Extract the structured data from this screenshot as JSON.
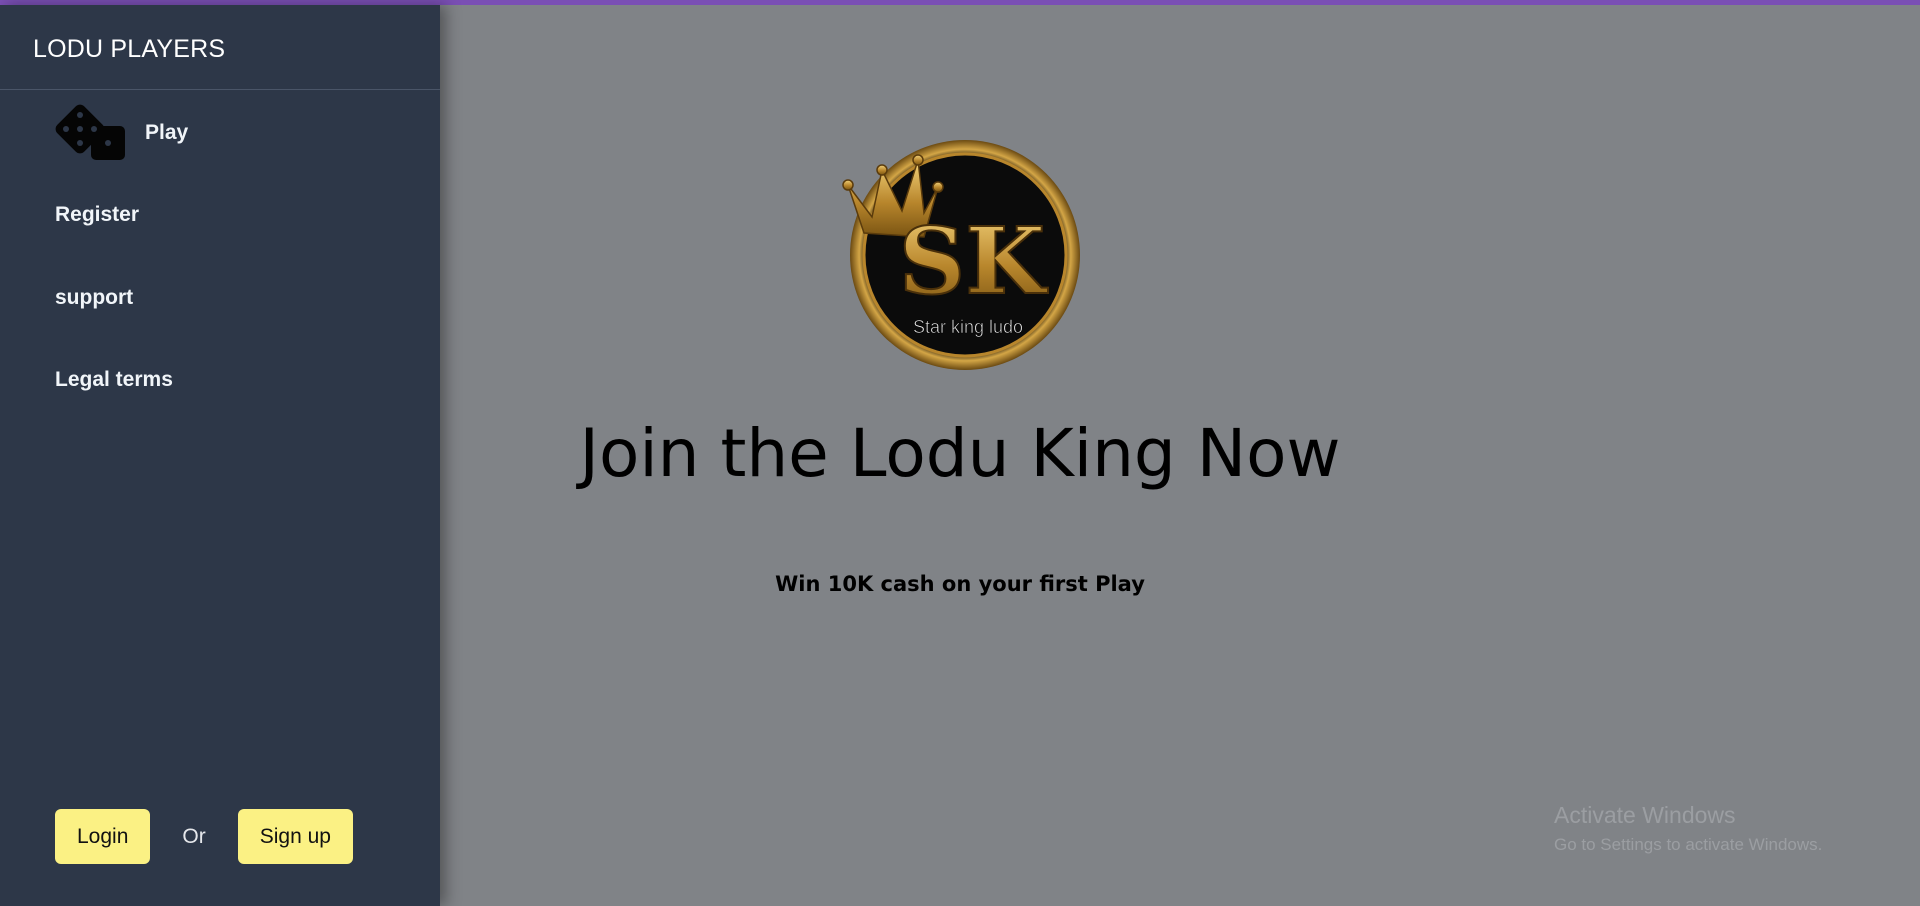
{
  "sidebar": {
    "brand": "LODU PLAYERS",
    "nav": {
      "play": "Play",
      "register": "Register",
      "support": "support",
      "legal": "Legal terms"
    },
    "auth": {
      "login": "Login",
      "or": "Or",
      "signup": "Sign up"
    }
  },
  "main": {
    "logo": {
      "monogram": "SK",
      "caption": "Star king ludo"
    },
    "title": "Join the Lodu King Now",
    "subtitle": "Win 10K cash on your first Play"
  },
  "watermark": {
    "title": "Activate Windows",
    "subtitle": "Go to Settings to activate Windows."
  },
  "colors": {
    "accent_bar": "#7a4fb4",
    "sidebar_bg": "#2d3748",
    "overlay_bg": "#808387",
    "button_bg": "#fbf184"
  },
  "icons": {
    "play": "dice-icon"
  }
}
